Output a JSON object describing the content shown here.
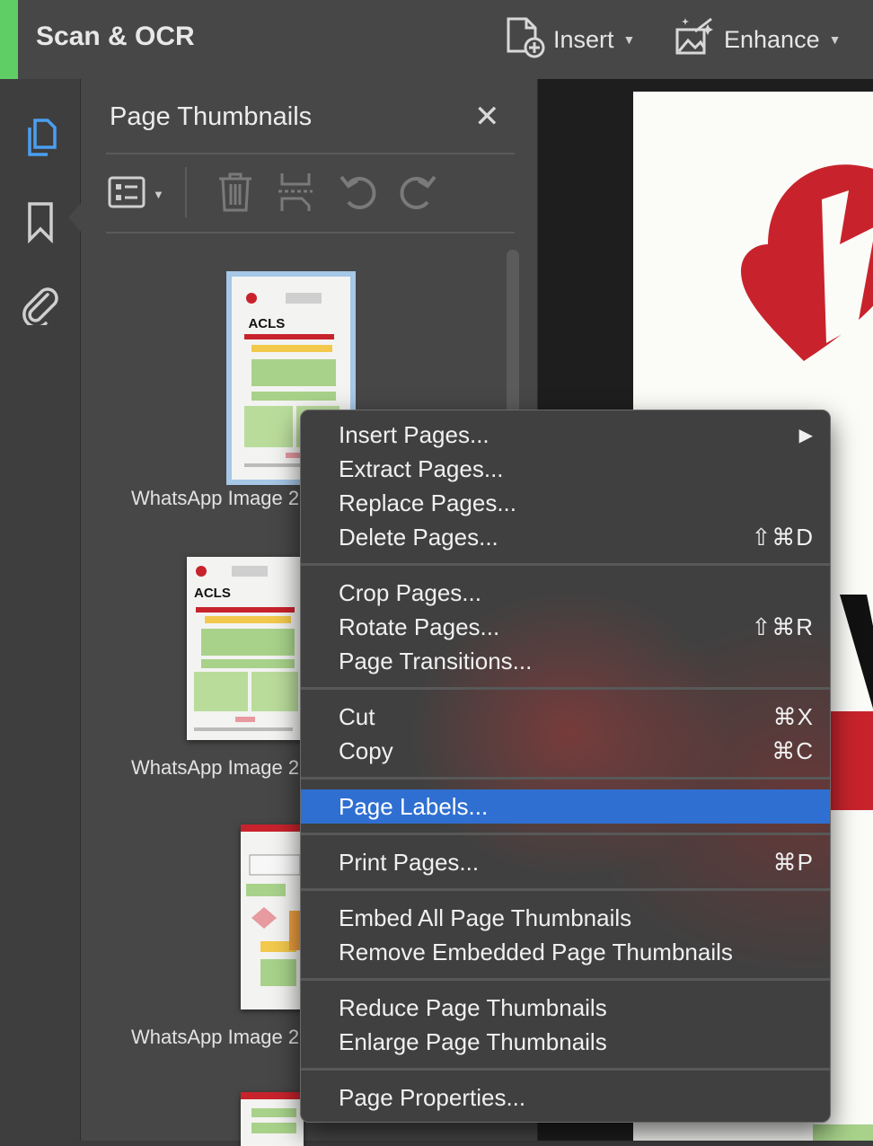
{
  "app": {
    "title": "Scan & OCR"
  },
  "toolbar": {
    "insert_label": "Insert",
    "enhance_label": "Enhance"
  },
  "panel": {
    "title": "Page Thumbnails",
    "close_glyph": "✕",
    "thumbnails": [
      {
        "label": "WhatsApp Image 2",
        "selected": true
      },
      {
        "label": "WhatsApp Image 2",
        "selected": false
      },
      {
        "label": "WhatsApp Image 2",
        "selected": false
      }
    ]
  },
  "thumb_text": {
    "acls": "ACLS"
  },
  "context_menu": {
    "insert_pages": "Insert Pages...",
    "submenu_arrow": "▶",
    "extract_pages": "Extract Pages...",
    "replace_pages": "Replace Pages...",
    "delete_pages": "Delete Pages...",
    "delete_shortcut": "⇧⌘D",
    "crop_pages": "Crop Pages...",
    "rotate_pages": "Rotate Pages...",
    "rotate_shortcut": "⇧⌘R",
    "page_transitions": "Page Transitions...",
    "cut": "Cut",
    "cut_shortcut": "⌘X",
    "copy": "Copy",
    "copy_shortcut": "⌘C",
    "page_labels": "Page Labels...",
    "print_pages": "Print Pages...",
    "print_shortcut": "⌘P",
    "embed_all": "Embed All Page Thumbnails",
    "remove_embedded": "Remove Embedded Page Thumbnails",
    "reduce_thumbs": "Reduce Page Thumbnails",
    "enlarge_thumbs": "Enlarge Page Thumbnails",
    "page_properties": "Page Properties..."
  },
  "colors": {
    "accent_green": "#5fcf65",
    "highlight_blue": "#2f6fd1",
    "active_icon_blue": "#4a9ff0",
    "logo_red": "#c8232c"
  }
}
